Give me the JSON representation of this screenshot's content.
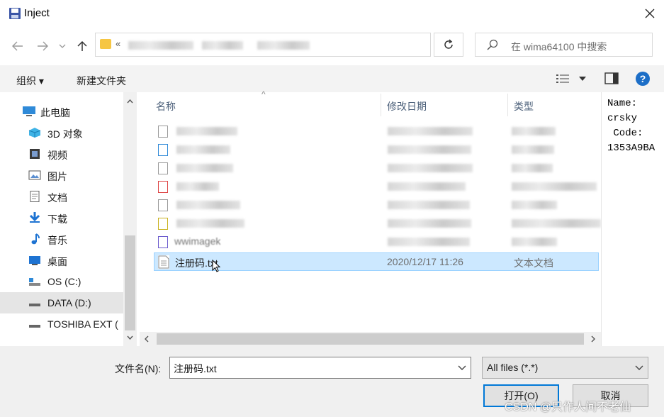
{
  "window": {
    "title": "Inject"
  },
  "address": {
    "prefix": "«"
  },
  "search": {
    "placeholder": "在 wima64100 中搜索"
  },
  "toolbar": {
    "organize": "组织 ▾",
    "new_folder": "新建文件夹"
  },
  "tree": {
    "items": [
      {
        "label": "此电脑",
        "icon": "computer-icon"
      },
      {
        "label": "3D 对象",
        "icon": "cube-icon"
      },
      {
        "label": "视频",
        "icon": "video-icon"
      },
      {
        "label": "图片",
        "icon": "picture-icon"
      },
      {
        "label": "文档",
        "icon": "document-icon"
      },
      {
        "label": "下载",
        "icon": "download-icon"
      },
      {
        "label": "音乐",
        "icon": "music-icon"
      },
      {
        "label": "桌面",
        "icon": "desktop-icon"
      },
      {
        "label": "OS (C:)",
        "icon": "drive-icon"
      },
      {
        "label": "DATA (D:)",
        "icon": "drive-icon"
      },
      {
        "label": "TOSHIBA EXT (",
        "icon": "drive-icon"
      }
    ]
  },
  "columns": {
    "name": "名称",
    "date": "修改日期",
    "type": "类型"
  },
  "files": {
    "selected": {
      "name": "注册码.txt",
      "date": "2020/12/17 11:26",
      "type": "文本文档"
    },
    "partial_name": "wwimagek"
  },
  "preview": {
    "text": "Name:\ncrsky\n Code:\n1353A9BA"
  },
  "bottom": {
    "filename_label": "文件名(N):",
    "filename_value": "注册码.txt",
    "filter_value": "All files (*.*)",
    "open_label": "打开(O)",
    "cancel_label": "取消"
  },
  "watermark": "CSDN @只作人间不老仙",
  "colors": {
    "accent": "#0078d7",
    "selection": "#cce8ff",
    "help": "#1c6ec7"
  }
}
